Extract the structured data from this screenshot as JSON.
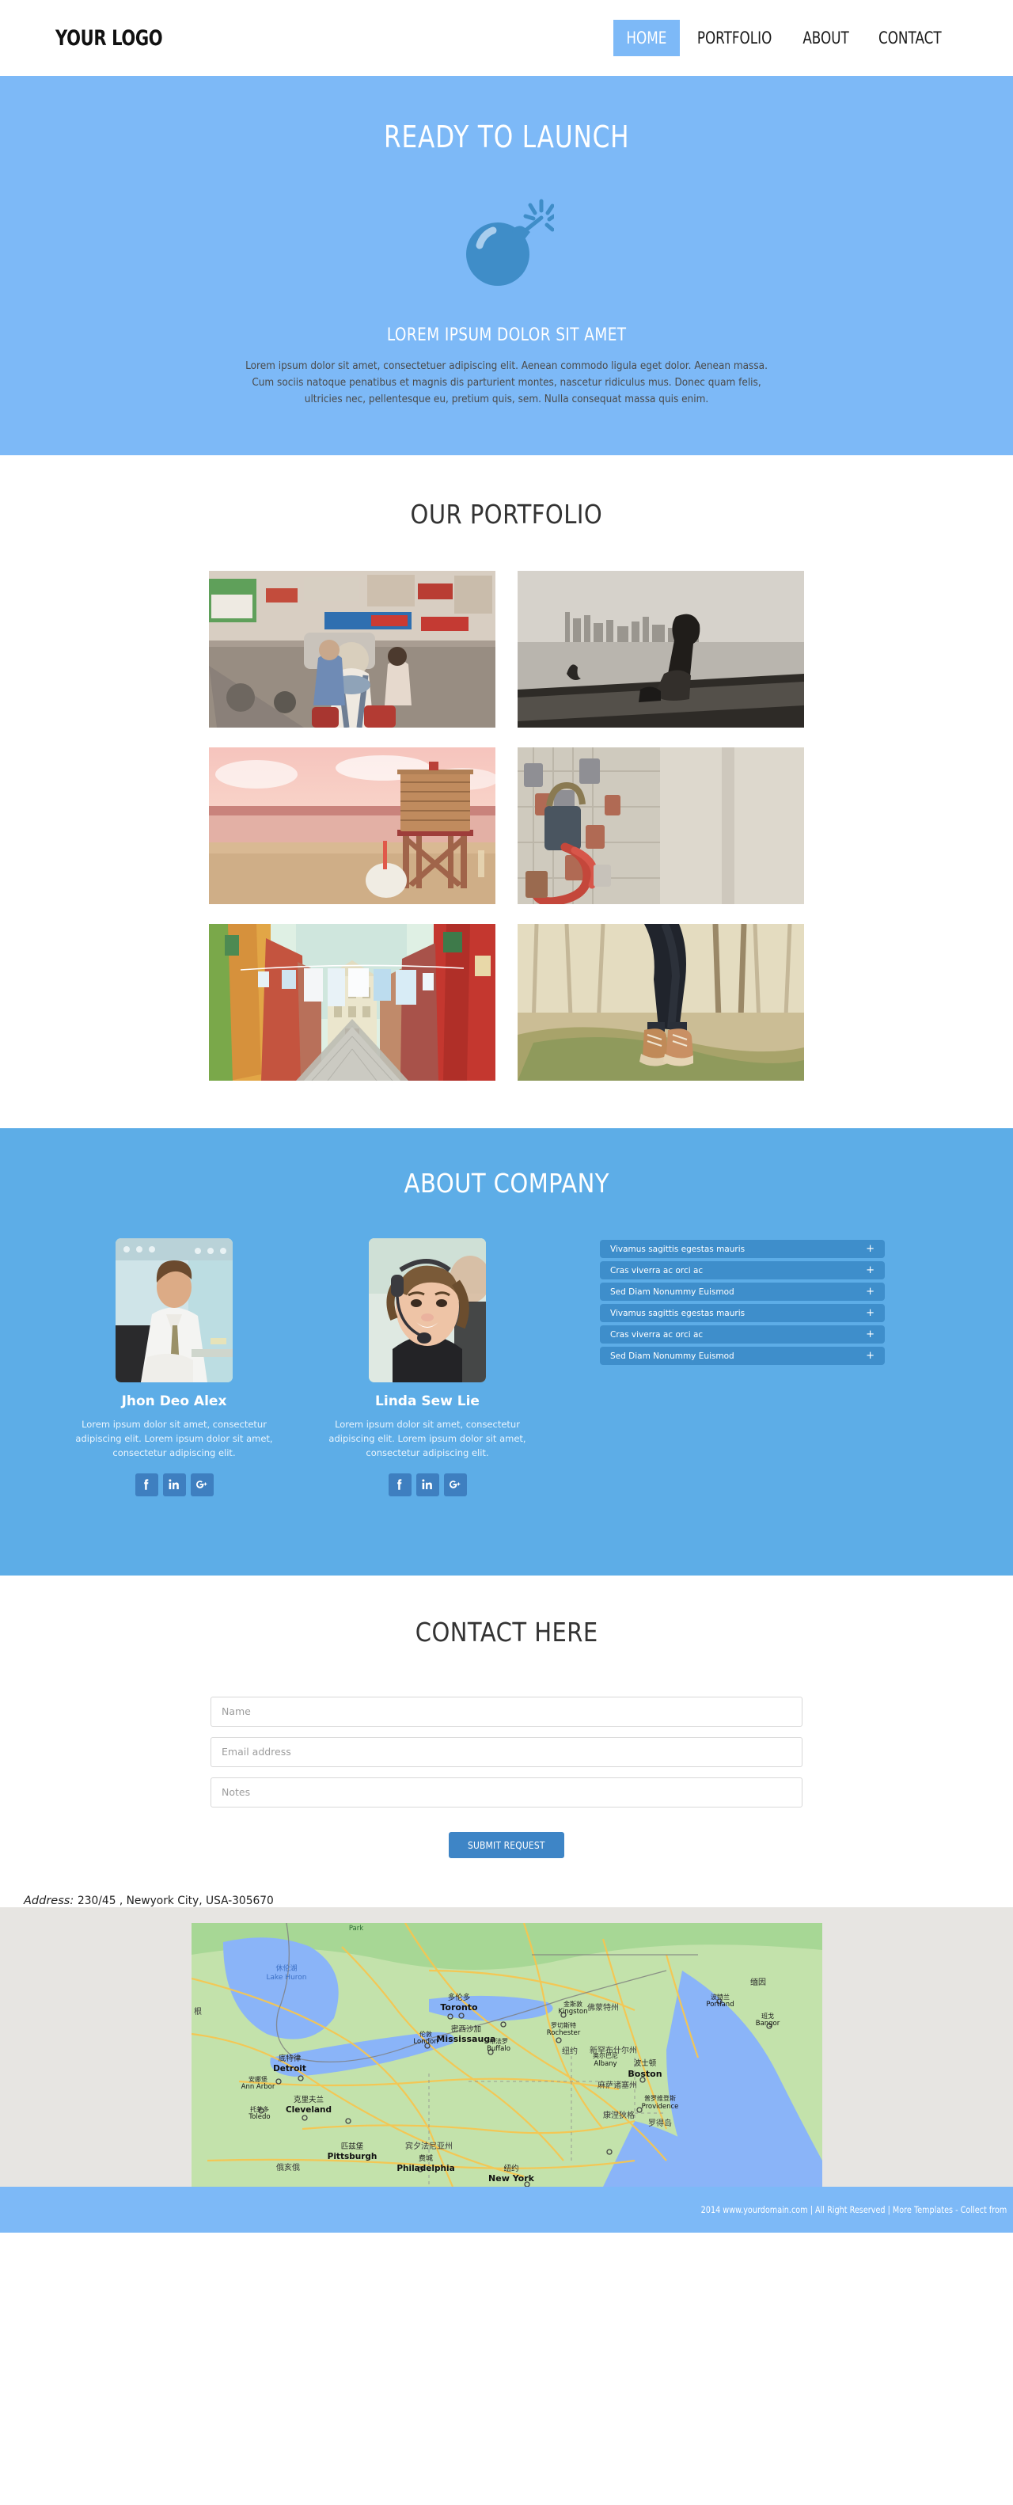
{
  "header": {
    "logo": "YOUR LOGO",
    "nav": [
      {
        "label": "HOME",
        "active": true
      },
      {
        "label": "PORTFOLIO",
        "active": false
      },
      {
        "label": "ABOUT",
        "active": false
      },
      {
        "label": "CONTACT",
        "active": false
      }
    ]
  },
  "hero": {
    "title": "READY TO LAUNCH",
    "icon": "bomb-icon",
    "subtitle": "LOREM IPSUM DOLOR SIT AMET",
    "paragraph": "Lorem ipsum dolor sit amet, consectetuer adipiscing elit. Aenean commodo ligula eget dolor. Aenean massa. Cum sociis natoque penatibus et magnis dis parturient montes, nascetur ridiculus mus. Donec quam felis, ultricies nec, pellentesque eu, pretium quis, sem. Nulla consequat massa quis enim.",
    "bg_color": "#7db9f7"
  },
  "portfolio": {
    "title": "OUR PORTFOLIO",
    "items": [
      {
        "alt": "busy-street-market-with-backpacker"
      },
      {
        "alt": "black-and-white-man-sitting-by-city-skyline"
      },
      {
        "alt": "lifeguard-tower-at-beach-sunset"
      },
      {
        "alt": "love-padlocks-on-fence"
      },
      {
        "alt": "colorful-alley-with-hanging-laundry"
      },
      {
        "alt": "legs-in-boots-standing-on-mossy-log"
      }
    ]
  },
  "about": {
    "title": "ABOUT COMPANY",
    "bg_color": "#5dade7",
    "members": [
      {
        "name": "Jhon Deo Alex",
        "bio": "Lorem ipsum dolor sit amet, consectetur adipiscing elit. Lorem ipsum dolor sit amet, consectetur adipiscing elit.",
        "photo_alt": "businessman-in-white-shirt-and-tie",
        "socials": [
          "facebook-icon",
          "linkedin-icon",
          "google-plus-icon"
        ]
      },
      {
        "name": "Linda Sew Lie",
        "bio": "Lorem ipsum dolor sit amet, consectetur adipiscing elit. Lorem ipsum dolor sit amet, consectetur adipiscing elit.",
        "photo_alt": "smiling-support-agent-with-headset",
        "socials": [
          "facebook-icon",
          "linkedin-icon",
          "google-plus-icon"
        ]
      }
    ],
    "accordion": [
      {
        "label": "Vivamus sagittis egestas mauris",
        "toggle": "+"
      },
      {
        "label": "Cras viverra ac orci ac",
        "toggle": "+"
      },
      {
        "label": "Sed Diam Nonummy Euismod",
        "toggle": "+"
      },
      {
        "label": "Vivamus sagittis egestas mauris",
        "toggle": "+"
      },
      {
        "label": "Cras viverra ac orci ac",
        "toggle": "+"
      },
      {
        "label": "Sed Diam Nonummy Euismod",
        "toggle": "+"
      }
    ]
  },
  "contact": {
    "title": "CONTACT HERE",
    "fields": [
      {
        "name": "name",
        "placeholder": "Name",
        "value": ""
      },
      {
        "name": "email",
        "placeholder": "Email address",
        "value": ""
      },
      {
        "name": "notes",
        "placeholder": "Notes",
        "value": ""
      }
    ],
    "submit_label": "SUBMIT REQUEST",
    "address_label": "Address:",
    "address_value": "230/45 , Newyork City, USA-305670"
  },
  "map": {
    "alt": "google-map-northeast-usa-great-lakes",
    "labels": [
      "Lake Huron",
      "休伦湖",
      "Toronto",
      "多伦多",
      "Mississauga",
      "密西沙加",
      "Kingston",
      "金斯敦",
      "Rochester",
      "罗切斯特",
      "London",
      "伦敦",
      "Buffalo",
      "布法罗",
      "Detroit",
      "底特律",
      "Ann Arbor",
      "安娜堡",
      "Toledo",
      "托莱多",
      "Cleveland",
      "克里夫兰",
      "Pittsburgh",
      "匹兹堡",
      "Philadelphia",
      "费城",
      "New York",
      "纽约",
      "Boston",
      "波士顿",
      "Providence",
      "普罗维登斯",
      "Albany",
      "奥尔巴尼",
      "Portland",
      "波特兰",
      "Bangor",
      "班戈",
      "Park",
      "宾夕法尼亚州",
      "佛蒙特州",
      "新罕布什尔州",
      "麻萨诸塞州",
      "康涅狄格",
      "罗得岛",
      "缅因",
      "俄亥俄"
    ]
  },
  "footer": {
    "text": "2014 www.yourdomain.com | All Right Reserved | More Templates - Collect from",
    "bg_color": "#7db9f7"
  }
}
